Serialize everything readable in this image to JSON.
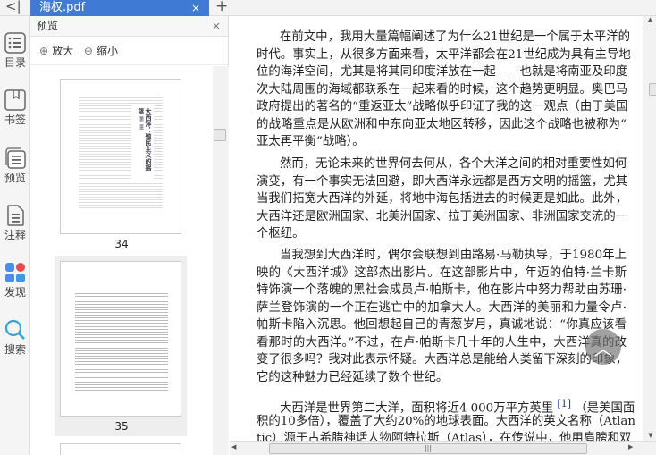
{
  "tabbar": {
    "back_icon": "collapse-left-icon",
    "tab_title": "海权.pdf",
    "close": "×",
    "add": "+"
  },
  "sidebar": {
    "items": [
      {
        "label": "目录",
        "icon": "list-icon"
      },
      {
        "label": "书签",
        "icon": "bookmark-icon"
      },
      {
        "label": "预览",
        "icon": "pages-icon"
      },
      {
        "label": "注释",
        "icon": "note-icon"
      },
      {
        "label": "发现",
        "icon": "apps-icon"
      },
      {
        "label": "搜索",
        "icon": "search-icon"
      }
    ]
  },
  "panel": {
    "title": "预览",
    "close": "×",
    "zoom_in": "放大",
    "zoom_out": "缩小",
    "pages": [
      {
        "number": "34",
        "chapter": "第二章",
        "title": "大西洋：殖民主义的摇篮"
      },
      {
        "number": "35"
      }
    ]
  },
  "document": {
    "paragraphs": [
      [
        "在前文中，我用大量篇幅阐述了为什么21世纪是一个属于太平洋的",
        "时代。事实上，从很多方面来看，太平洋都会在21世纪成为具有主导地",
        "位的海洋空间，尤其是将其同印度洋放在一起——也就是将南亚及印度",
        "次大陆周围的海域都联系在一起来看的时候，这个趋势更明显。奥巴马",
        "政府提出的著名的“重返亚太”战略似乎印证了我的这一观点（由于美国",
        "的战略重点是从欧洲和中东向亚太地区转移，因此这个战略也被称为“",
        "亚太再平衡”战略）。"
      ],
      [
        "然而，无论未来的世界何去何从，各个大洋之间的相对重要性如何",
        "演变，有一个事实无法回避，即大西洋永远都是西方文明的摇篮，尤其",
        "当我们拓宽大西洋的外延，将地中海包括进去的时候更是如此。此外，",
        "大西洋还是欧洲国家、北美洲国家、拉丁美洲国家、非洲国家交流的一",
        "个枢纽。"
      ],
      [
        "当我想到大西洋时，偶尔会联想到由路易·马勒执导，于1980年上",
        "映的《大西洋城》这部杰出影片。在这部影片中，年迈的伯特·兰卡斯",
        "特饰演一个落魄的黑社会成员卢·帕斯卡，他在影片中努力帮助由苏珊·",
        "萨兰登饰演的一个正在逃亡中的加拿大人。大西洋的美丽和力量令卢·",
        "帕斯卡陷入沉思。他回想起自己的青葱岁月，真诚地说：“你真应该看",
        "看那时的大西洋。”不过，在卢·帕斯卡几十年的人生中，大西洋真的改",
        "变了很多吗？我对此表示怀疑。大西洋总是能给人类留下深刻的印象，",
        "它的这种魅力已经延续了数个世纪。"
      ]
    ],
    "p4": {
      "l1a": "大西洋是世界第二大洋，面积将近4 000万平方英里",
      "footnote": "[1]",
      "l1b": "（是美国面",
      "l2": "积的10多倍），覆盖了大约20%的地球表面。大西洋的英文名称（Atlan",
      "l3": "tic）源于古希腊神话人物阿特拉斯（Atlas），在传说中，他用肩膀和双"
    }
  },
  "scroll_top_icon": "chevron-up-icon"
}
